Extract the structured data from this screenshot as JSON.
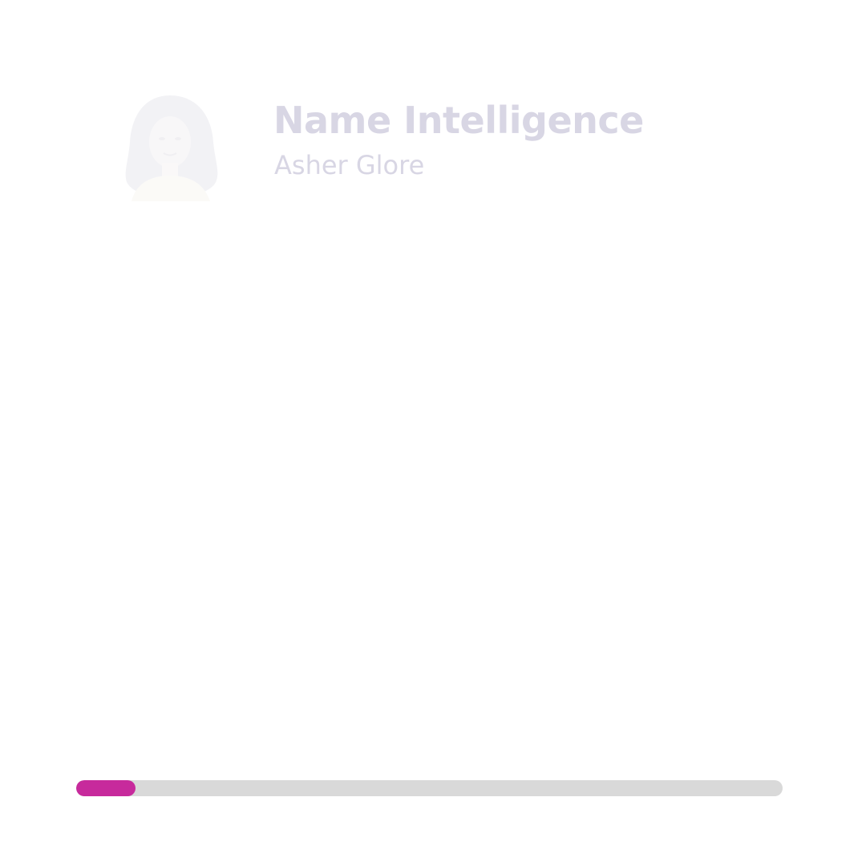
{
  "header": {
    "title": "Name Intelligence",
    "subtitle": "Asher Glore"
  },
  "avatar": {
    "icon": "person-portrait-icon"
  },
  "progress": {
    "fraction": 0.084,
    "fill_color": "#c72a9c",
    "track_color": "#d9d9d9"
  },
  "colors": {
    "text_muted": "#d8d6e4",
    "background": "#ffffff"
  }
}
